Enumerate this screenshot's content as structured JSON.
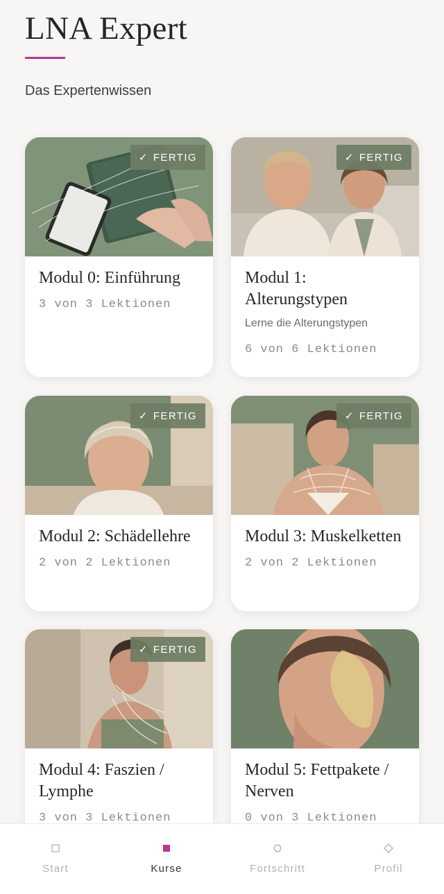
{
  "app": {
    "title": "LNA Expert",
    "subtitle": "Das Expertenwissen",
    "accent_color": "#b33a93"
  },
  "badge": {
    "label": "FERTIG",
    "icon": "check-icon"
  },
  "modules": [
    {
      "title": "Modul 0: Einführung",
      "description": "",
      "count": "3 von 3 Lektionen",
      "done": true,
      "image": "tablet-with-fibers"
    },
    {
      "title": "Modul 1: Alterungstypen",
      "description": "Lerne die Alterungstypen",
      "count": "6 von 6 Lektionen",
      "done": true,
      "image": "two-women-portrait"
    },
    {
      "title": "Modul 2: Schädellehre",
      "description": "",
      "count": "2 von 2 Lektionen",
      "done": true,
      "image": "woman-skull-overlay"
    },
    {
      "title": "Modul 3: Muskelketten",
      "description": "",
      "count": "2 von 2 Lektionen",
      "done": true,
      "image": "woman-muscle-overlay"
    },
    {
      "title": "Modul 4: Faszien / Lymphe",
      "description": "",
      "count": "3 von 3 Lektionen",
      "done": true,
      "image": "woman-fascia-overlay"
    },
    {
      "title": "Modul 5: Fettpakete / Nerven",
      "description": "",
      "count": "0 von 3 Lektionen",
      "done": false,
      "image": "woman-fat-pads-overlay"
    }
  ],
  "nav": [
    {
      "label": "Start",
      "icon": "square-outline-icon",
      "active": false
    },
    {
      "label": "Kurse",
      "icon": "square-filled-icon",
      "active": true
    },
    {
      "label": "Fortschritt",
      "icon": "circle-outline-icon",
      "active": false
    },
    {
      "label": "Profil",
      "icon": "diamond-outline-icon",
      "active": false
    }
  ]
}
